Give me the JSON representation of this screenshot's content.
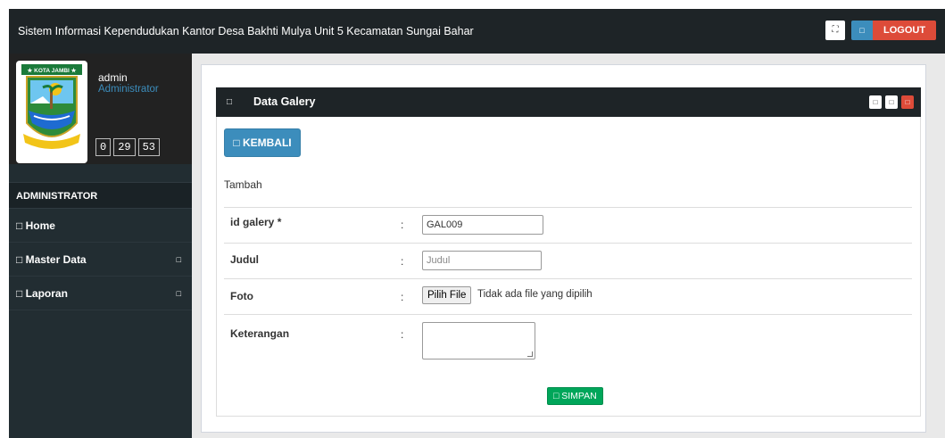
{
  "header": {
    "title": "Sistem Informasi Kependudukan Kantor Desa Bakhti Mulya Unit 5 Kecamatan Sungai Bahar",
    "fullscreen_icon": "expand-icon",
    "logout_icon": "glyph-box",
    "logout_label": "LOGOUT"
  },
  "sidebar": {
    "logo_text": "★ KOTA JAMBI ★",
    "username": "admin",
    "role": "Administrator",
    "clock": {
      "h": "0",
      "m": "29",
      "s": "53"
    },
    "section_header": "ADMINISTRATOR",
    "items": [
      {
        "label": "□ Home",
        "has_caret": false
      },
      {
        "label": "□ Master Data",
        "has_caret": true,
        "caret": "□"
      },
      {
        "label": "□ Laporan",
        "has_caret": true,
        "caret": "□"
      }
    ]
  },
  "box": {
    "icon": "□",
    "title": "Data Galery",
    "tools": [
      "□",
      "□",
      "□"
    ]
  },
  "form": {
    "back_button": "□ KEMBALI",
    "subtitle": "Tambah",
    "fields": {
      "id_galery": {
        "label": "id galery *",
        "value": "GAL009"
      },
      "judul": {
        "label": "Judul",
        "placeholder": "Judul"
      },
      "foto": {
        "label": "Foto",
        "button": "Pilih File",
        "status": "Tidak ada file yang dipilih"
      },
      "keterangan": {
        "label": "Keterangan"
      }
    },
    "colon": ":",
    "submit_button": "□ SIMPAN"
  },
  "colors": {
    "topbar": "#1e2427",
    "primary": "#3c8dbc",
    "danger": "#dd4b39",
    "success": "#00a65a"
  }
}
